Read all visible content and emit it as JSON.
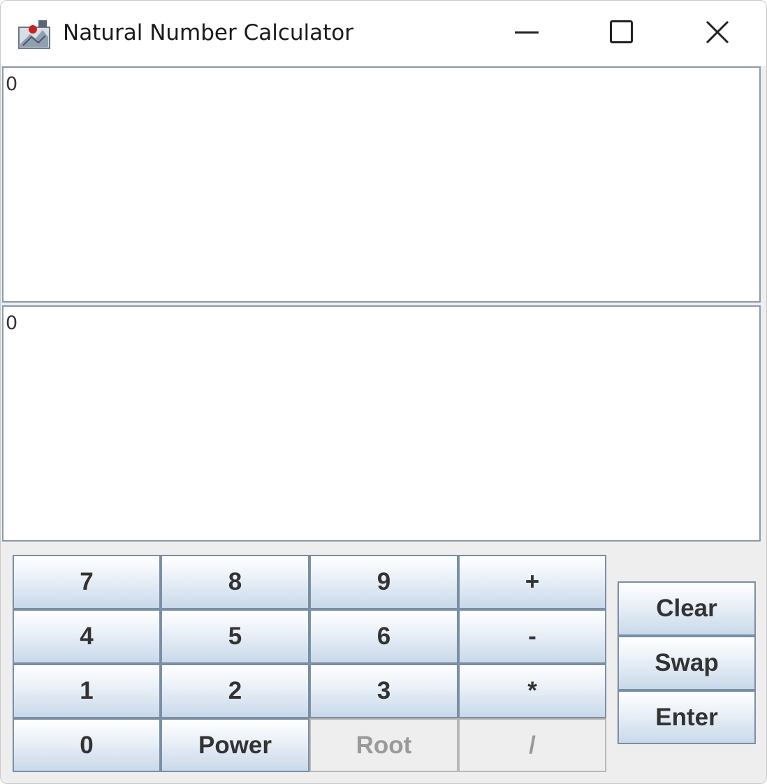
{
  "window": {
    "title": "Natural Number Calculator"
  },
  "display": {
    "top_value": "0",
    "bottom_value": "0"
  },
  "keypad": {
    "rows": [
      [
        "7",
        "8",
        "9",
        "+"
      ],
      [
        "4",
        "5",
        "6",
        "-"
      ],
      [
        "1",
        "2",
        "3",
        "*"
      ],
      [
        "0",
        "Power",
        "Root",
        "/"
      ]
    ],
    "disabled": [
      "Root",
      "/"
    ]
  },
  "side_buttons": {
    "clear": "Clear",
    "swap": "Swap",
    "enter": "Enter"
  },
  "colors": {
    "button_border": "#7a8ea4",
    "button_gradient_bottom": "#c9d9ea",
    "disabled_text": "#9a9a9a"
  }
}
